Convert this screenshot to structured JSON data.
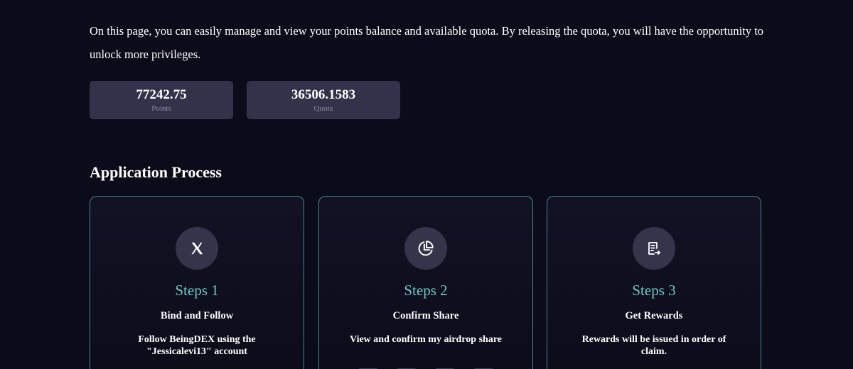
{
  "intro": {
    "text": "On this page, you can easily manage and view your points balance and available quota. By releasing the quota, you will have the opportunity to unlock more privileges."
  },
  "stats": {
    "points": {
      "value": "77242.75",
      "label": "Points"
    },
    "quota": {
      "value": "36506.1583",
      "label": "Quota"
    }
  },
  "process": {
    "title": "Application Process",
    "steps": [
      {
        "number": "Steps 1",
        "title": "Bind and Follow",
        "description": "Follow BeingDEX using the \"Jessicalevi13\" account",
        "icon": "x-logo-icon"
      },
      {
        "number": "Steps 2",
        "title": "Confirm Share",
        "description": "View and confirm my airdrop share",
        "icon": "pie-chart-icon"
      },
      {
        "number": "Steps 3",
        "title": "Get Rewards",
        "description": "Rewards will be issued in order of claim.",
        "icon": "receipt-icon"
      }
    ]
  },
  "colors": {
    "background": "#0c0b1a",
    "card_border": "#3f8a8c",
    "accent": "#6dc7c4",
    "stat_card": "#33324a",
    "icon_circle": "#34344a"
  }
}
